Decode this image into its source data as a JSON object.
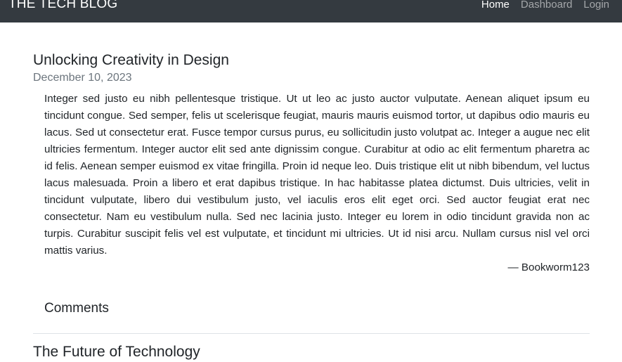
{
  "nav": {
    "brand": "THE TECH BLOG",
    "links": [
      {
        "label": "Home"
      },
      {
        "label": "Dashboard"
      },
      {
        "label": "Login"
      }
    ]
  },
  "posts": [
    {
      "title": "Unlocking Creativity in Design",
      "date": "December 10, 2023",
      "body": "Integer sed justo eu nibh pellentesque tristique. Ut ut leo ac justo auctor vulputate. Aenean aliquet ipsum eu tincidunt congue. Sed semper, felis ut scelerisque feugiat, mauris mauris euismod tortor, ut dapibus odio mauris eu lacus. Sed ut consectetur erat. Fusce tempor cursus purus, eu sollicitudin justo volutpat ac. Integer a augue nec elit ultricies fermentum. Integer auctor elit sed ante dignissim congue. Curabitur at odio ac elit fermentum pharetra ac id felis. Aenean semper euismod ex vitae fringilla. Proin id neque leo. Duis tristique elit ut nibh bibendum, vel luctus lacus malesuada. Proin a libero et erat dapibus tristique. In hac habitasse platea dictumst. Duis ultricies, velit in tincidunt vulputate, libero dui vestibulum justo, vel iaculis eros elit eget orci. Sed auctor feugiat erat nec consectetur. Nam eu vestibulum nulla. Sed nec lacinia justo. Integer eu lorem in odio tincidunt gravida non ac turpis. Curabitur suscipit felis vel est vulputate, et tincidunt mi ultricies. Ut id nisi arcu. Nullam cursus nisl vel orci mattis varius.",
      "author": "— Bookworm123",
      "comments_title": "Comments"
    },
    {
      "title": "The Future of Technology"
    }
  ]
}
